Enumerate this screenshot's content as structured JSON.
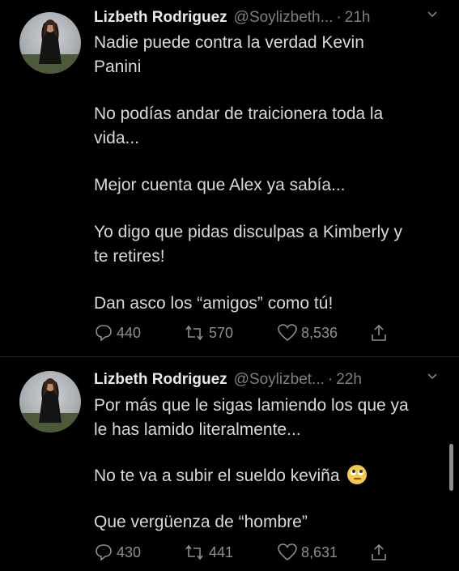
{
  "tweets": [
    {
      "name": "Lizbeth Rodriguez",
      "handle": "@Soylizbeth...",
      "dot": "·",
      "time": "21h",
      "lines": [
        "Nadie puede contra la verdad Kevin",
        "Panini",
        "No podías andar de traicionera toda la",
        "vida...",
        "Mejor cuenta que Alex ya sabía...",
        "Yo digo que pidas disculpas a Kimberly y",
        "te retires!",
        "Dan asco los “amigos” como tú!"
      ],
      "replies": "440",
      "retweets": "570",
      "likes": "8,536"
    },
    {
      "name": "Lizbeth Rodriguez",
      "handle": "@Soylizbet...",
      "dot": "·",
      "time": "22h",
      "lines": [
        "Por más que le sigas lamiendo los que ya",
        "le has lamido literalmente...",
        "No te va a subir el sueldo keviña",
        "Que vergüenza de “hombre”"
      ],
      "emoji": "face-with-rolling-eyes-emoji",
      "replies": "430",
      "retweets": "441",
      "likes": "8,631"
    }
  ],
  "colors": {
    "background": "#000000",
    "text": "#d9d9d9",
    "muted": "#7b8085"
  },
  "icons": [
    "reply-icon",
    "retweet-icon",
    "like-icon",
    "share-icon",
    "chevron-down-icon"
  ]
}
